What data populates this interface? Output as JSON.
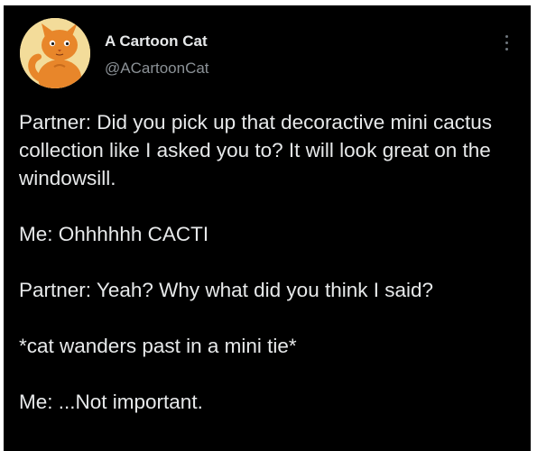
{
  "author": {
    "name": "A Cartoon Cat",
    "handle": "@ACartoonCat",
    "avatar_icon": "cartoon-cat-avatar"
  },
  "menu_icon": "more-options-icon",
  "tweet": {
    "paragraphs": [
      "Partner: Did you pick up that decoractive mini cactus collection like I asked you to? It will look great on the windowsill.",
      "Me: Ohhhhhh CACTI",
      "Partner: Yeah? Why what did you think I said?",
      "*cat wanders past in a mini tie*",
      "Me: ...Not important."
    ]
  },
  "colors": {
    "background": "#000000",
    "text": "#e7e9ea",
    "secondary_text": "#8b9196",
    "avatar_bg": "#f3dc9a",
    "cat_orange": "#e8862a"
  }
}
